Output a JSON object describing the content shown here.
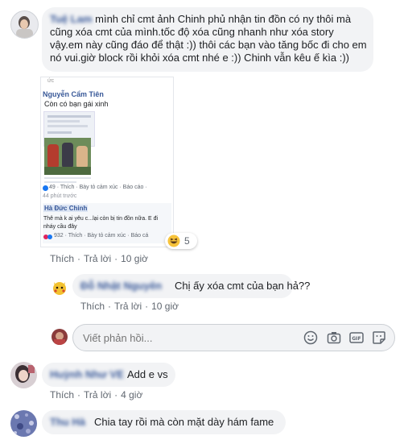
{
  "comment1": {
    "author": "Tuệ Lam",
    "text": "mình chỉ cmt ảnh Chinh phủ nhận tin đồn có ny thôi mà cũng xóa cmt của mình.tốc độ xóa cũng nhanh như xóa story vậy.em này cũng đáo để thật :)) thôi các bạn vào tăng bốc đi cho em nó vui.giờ block rồi khỏi xóa cmt nhé e :)) Chinh vẫn kêu ế kìa :))",
    "actions": {
      "like": "Thích",
      "reply": "Trả lời",
      "time": "10 giờ"
    },
    "reaction_count": "5"
  },
  "embedded_screenshot": {
    "header": "ức",
    "post_author": "Nguyễn Cẩm Tiên",
    "post_text": "Còn có bạn gái xinh",
    "post_meta": "49 · Thích · Bày tỏ cảm xúc · Báo cáo ·",
    "post_time": "44 phút trước",
    "reply_author": "Hà Đức Chinh",
    "reply_text_1": "Thê mà k ai yêu c...lại còn bị tin đồn nữa. E đi",
    "reply_text_2": "nháy cầu đây",
    "reply_meta": "932 · Thích · Bày tỏ cảm xúc · Báo cá"
  },
  "reply1": {
    "author": "Đỗ Nhật Nguyên",
    "text": "Chị ấy xóa cmt của bạn hả??",
    "actions": {
      "like": "Thích",
      "reply": "Trả lời",
      "time": "10 giờ"
    }
  },
  "reply_input": {
    "placeholder": "Viết phản hồi..."
  },
  "comment2": {
    "author": "Huỳnh Như VE",
    "text": "Add e vs",
    "actions": {
      "like": "Thích",
      "reply": "Trả lời",
      "time": "4 giờ"
    }
  },
  "comment3": {
    "author": "Thu Hà",
    "text": "Chia tay rồi mà còn mặt dày hám fame"
  },
  "icons": [
    "emoji-icon",
    "camera-icon",
    "gif-icon",
    "sticker-icon",
    "haha-reaction-icon",
    "like-reaction-icon"
  ],
  "colors": {
    "link": "#385898",
    "bubble": "#f2f3f5",
    "meta": "#606770"
  }
}
